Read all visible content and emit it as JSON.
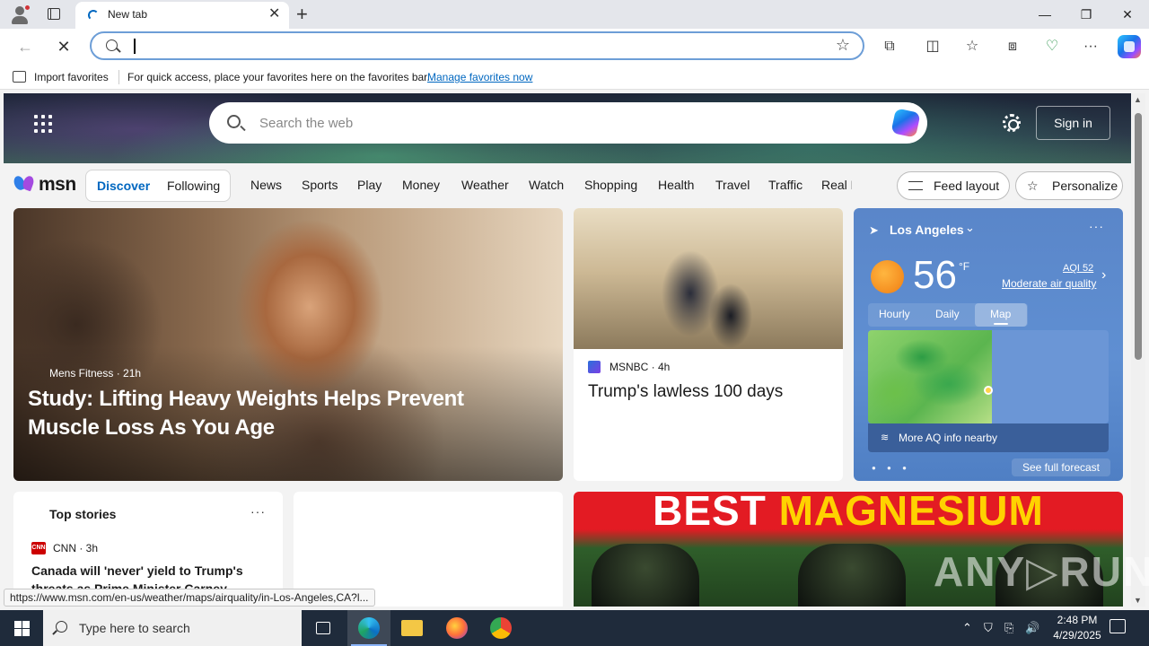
{
  "browser": {
    "tab": {
      "title": "New tab",
      "close": "✕"
    },
    "new_tab": "+",
    "window": {
      "minimize": "—",
      "restore": "❐",
      "close": "✕"
    },
    "nav": {
      "back": "←",
      "stop": "✕"
    },
    "address": {
      "value": "",
      "favorite_icon": "☆"
    },
    "toolbar": {
      "extensions": "⧉",
      "split": "◫",
      "favorites": "☆",
      "collections": "⧈",
      "browser_essentials": "♡",
      "more": "···"
    }
  },
  "favorites_bar": {
    "import_label": "Import favorites",
    "message": "For quick access, place your favorites here on the favorites bar.",
    "manage_link": "Manage favorites now"
  },
  "msn": {
    "search_placeholder": "Search the web",
    "sign_in": "Sign in",
    "logo_text": "msn",
    "feed_tabs": {
      "discover": "Discover",
      "following": "Following"
    },
    "nav_items": [
      "News",
      "Sports",
      "Play",
      "Money",
      "Weather",
      "Watch",
      "Shopping",
      "Health",
      "Travel",
      "Traffic",
      "Real E"
    ],
    "feed_layout": "Feed layout",
    "personalize": "Personalize",
    "hero": {
      "source": "Mens Fitness · 21h",
      "headline": "Study: Lifting Heavy Weights Helps Prevent Muscle Loss As You Age"
    },
    "news": {
      "source": "MSNBC · 4h",
      "headline": "Trump's lawless 100 days"
    },
    "weather": {
      "location": "Los Angeles",
      "chevron": "⌄",
      "more": "···",
      "temperature": "56",
      "unit": "°F",
      "aqi": "AQI 52",
      "aqi_text": "Moderate air quality",
      "next": "›",
      "tabs": [
        "Hourly",
        "Daily",
        "Map"
      ],
      "selected_tab": "Map",
      "aq_more": "More AQ info nearby",
      "dots": "● ● ●",
      "full_forecast": "See full forecast"
    },
    "top_stories": {
      "title": "Top stories",
      "more": "···",
      "source": "CNN · 3h",
      "headline": "Canada will 'never' yield to Trump's threats as Prime Minister Carney declar..."
    },
    "ad": {
      "text_white": "BEST ",
      "text_yellow": "MAGNESIUM"
    }
  },
  "status_url": "https://www.msn.com/en-us/weather/maps/airquality/in-Los-Angeles,CA?l...",
  "watermark": "ANY▷RUN",
  "scrollbar": {
    "up": "▲",
    "down": "▼"
  },
  "taskbar": {
    "search_placeholder": "Type here to search",
    "tray": {
      "chevron": "⌃",
      "network": "⎘",
      "volume": "🔊"
    },
    "time": "2:48 PM",
    "date": "4/29/2025"
  }
}
